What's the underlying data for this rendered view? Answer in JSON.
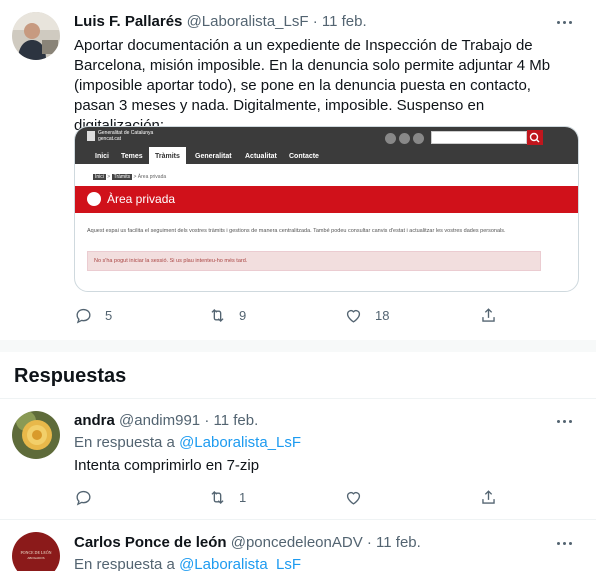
{
  "main_tweet": {
    "name": "Luis F. Pallarés",
    "handle": "@Laboralista_LsF",
    "separator": "·",
    "date": "11 feb.",
    "text": "Aportar documentación a un expediente de Inspección de Trabajo de Barcelona, misión imposible. En la denuncia solo permite adjuntar 4 Mb (imposible aportar todo), se pone en la denuncia puesta en contacto, pasan 3 meses y nada. Digitalmente, imposible. Suspenso en digitalización:",
    "actions": {
      "replies": "5",
      "retweets": "9",
      "likes": "18"
    },
    "embedded": {
      "logo_text": "Generalitat de Catalunya\ngencat.cat",
      "nav": [
        "Inici",
        "Temes",
        "Tràmits",
        "Generalitat",
        "Actualitat",
        "Contacte"
      ],
      "breadcrumb": [
        "Inici",
        "Tràmits",
        "Àrea privada"
      ],
      "banner_title": "Àrea privada",
      "intro": "Aquest espai us facilita el seguiment dels vostres tràmits i gestions de manera centralitzada. També podeu consultar canvis d'estat i actualitzar les vostres dades personals.",
      "alert": "No s'ha pogut iniciar la sessió. Si us plau intenteu-ho més tard."
    }
  },
  "section_title": "Respuestas",
  "replies": [
    {
      "name": "andra",
      "handle": "@andim991",
      "separator": "·",
      "date": "11 feb.",
      "reply_prefix": "En respuesta a",
      "reply_handle": "@Laboralista_LsF",
      "text": "Intenta comprimirlo en 7-zip",
      "actions": {
        "replies": "",
        "retweets": "1",
        "likes": ""
      }
    },
    {
      "name": "Carlos Ponce de león",
      "handle": "@poncedeleonADV",
      "separator": "·",
      "date": "11 feb.",
      "reply_prefix": "En respuesta a",
      "reply_handle": "@Laboralista_LsF",
      "avatar_text": "PONCE DE LEÓN",
      "avatar_subtext": "ABOGADOS"
    }
  ],
  "colors": {
    "accent": "#1d9bf0",
    "muted": "#536471",
    "gencat_red": "#d0111a"
  }
}
